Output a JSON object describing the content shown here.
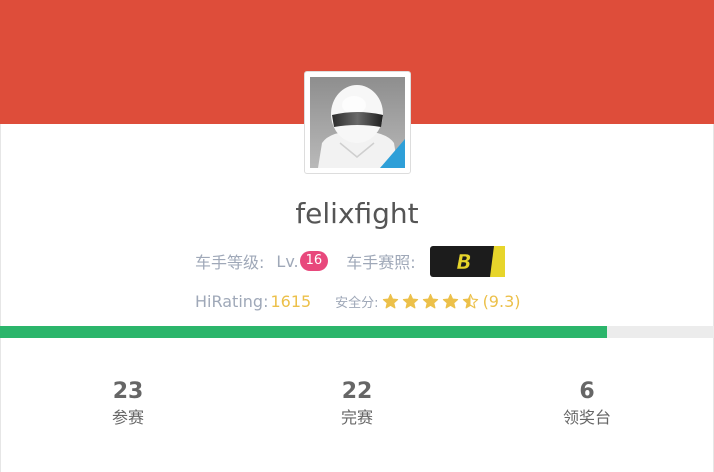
{
  "colors": {
    "banner": "#de4d3a",
    "level_badge": "#e8487c",
    "accent_gold": "#ecc04a",
    "progress_fill": "#2bb56b",
    "progress_track": "#ececec"
  },
  "profile": {
    "avatar_icon": "helmet-avatar-icon",
    "username": "felixfight",
    "level_label": "车手等级:",
    "level_prefix": "Lv.",
    "level_value": "16",
    "license_label": "车手赛照:",
    "license_grade": "B",
    "hirating_label": "HiRating:",
    "hirating_value": "1615",
    "safety_label": "安全分:",
    "safety_stars": 4.5,
    "safety_value": "(9.3)"
  },
  "progress": {
    "fraction": 0.85
  },
  "stats": [
    {
      "value": "23",
      "label": "参赛"
    },
    {
      "value": "22",
      "label": "完赛"
    },
    {
      "value": "6",
      "label": "领奖台"
    }
  ]
}
